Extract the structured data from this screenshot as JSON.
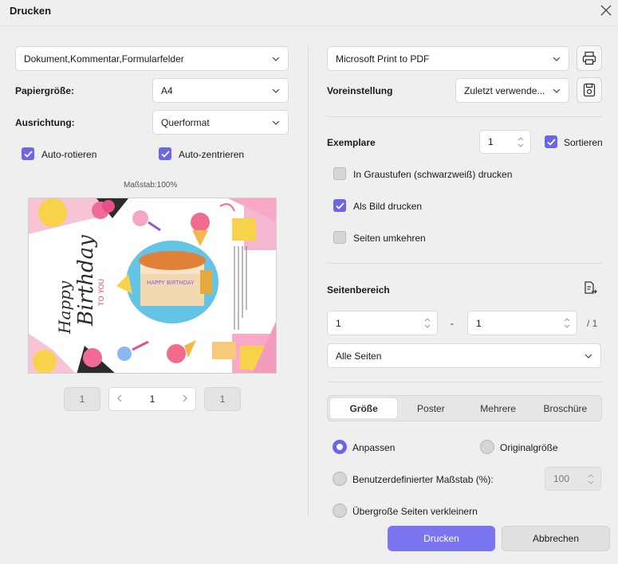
{
  "dialog": {
    "title": "Drucken"
  },
  "left": {
    "content_select": "Dokument,Kommentar,Formularfelder",
    "paper_size_label": "Papiergröße:",
    "paper_size_value": "A4",
    "orientation_label": "Ausrichtung:",
    "orientation_value": "Querformat",
    "auto_rotate_label": "Auto-rotieren",
    "auto_rotate": true,
    "auto_center_label": "Auto-zentrieren",
    "auto_center": true,
    "scale_label": "Maßstab:100%",
    "preview": {
      "text_happy": "Happy",
      "text_birthday": "Birthday",
      "text_to_you": "TO YOU",
      "cake_text": "HAPPY BIRTHDAY"
    },
    "pager": {
      "first": "1",
      "current": "1",
      "last": "1"
    }
  },
  "right": {
    "printer_value": "Microsoft Print to PDF",
    "preset_label": "Voreinstellung",
    "preset_value": "Zuletzt verwende...",
    "copies_label": "Exemplare",
    "copies_value": "1",
    "collate_label": "Sortieren",
    "collate": true,
    "grayscale_label": "In Graustufen (schwarzweiß) drucken",
    "grayscale": false,
    "as_image_label": "Als Bild drucken",
    "as_image": true,
    "reverse_label": "Seiten umkehren",
    "reverse": false,
    "page_range_label": "Seitenbereich",
    "range_from": "1",
    "range_dash": "-",
    "range_to": "1",
    "range_total": "/ 1",
    "pages_select": "Alle Seiten",
    "tabs": [
      "Größe",
      "Poster",
      "Mehrere",
      "Broschüre"
    ],
    "active_tab": "Größe",
    "fit_label": "Anpassen",
    "original_label": "Originalgröße",
    "custom_scale_label": "Benutzerdefinierter Maßstab (%):",
    "custom_scale_value": "100",
    "shrink_label": "Übergroße Seiten verkleinern",
    "selected_size_option": "Anpassen"
  },
  "footer": {
    "print_label": "Drucken",
    "cancel_label": "Abbrechen"
  },
  "colors": {
    "accent": "#6b66e8",
    "primary_button": "#7b76f0",
    "background": "#efefef"
  }
}
